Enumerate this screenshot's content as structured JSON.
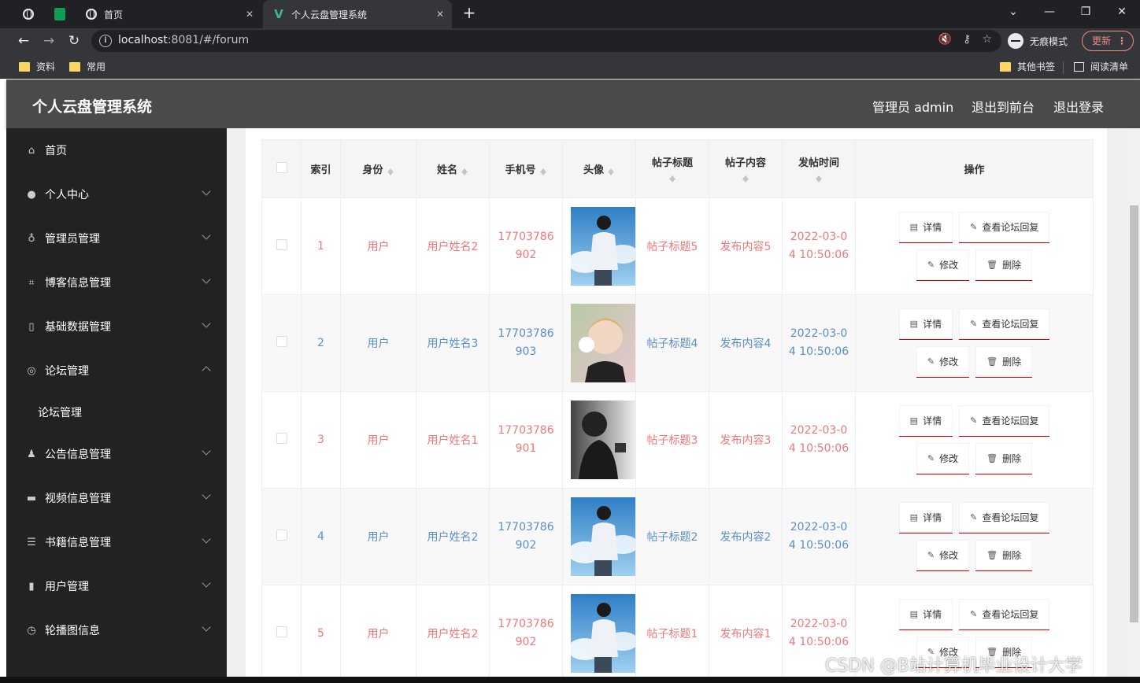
{
  "browser": {
    "tabs": [
      {
        "title": "首页"
      },
      {
        "title": "个人云盘管理系统"
      }
    ],
    "url_host": "localhost",
    "url_rest": ":8081/#/forum",
    "incognito_label": "无痕模式",
    "update_label": "更新",
    "bookmarks": [
      "资料",
      "常用"
    ],
    "bookmarks_right": [
      "其他书签",
      "阅读清单"
    ]
  },
  "app": {
    "title": "个人云盘管理系统",
    "header_links": [
      "管理员 admin",
      "退出到前台",
      "退出登录"
    ]
  },
  "sidebar": {
    "items": [
      {
        "label": "首页",
        "icon": "home-icon",
        "expandable": false
      },
      {
        "label": "个人中心",
        "icon": "user-icon",
        "expandable": true
      },
      {
        "label": "管理员管理",
        "icon": "microphone-icon",
        "expandable": true
      },
      {
        "label": "博客信息管理",
        "icon": "crop-icon",
        "expandable": true
      },
      {
        "label": "基础数据管理",
        "icon": "mic-icon",
        "expandable": true
      },
      {
        "label": "论坛管理",
        "icon": "compass-icon",
        "expandable": true,
        "expanded": true
      },
      {
        "label": "公告信息管理",
        "icon": "person-icon",
        "expandable": true
      },
      {
        "label": "视频信息管理",
        "icon": "monitor-icon",
        "expandable": true
      },
      {
        "label": "书籍信息管理",
        "icon": "list-icon",
        "expandable": true
      },
      {
        "label": "用户管理",
        "icon": "books-icon",
        "expandable": true
      },
      {
        "label": "轮播图信息",
        "icon": "clock-icon",
        "expandable": true
      }
    ],
    "subitem": "论坛管理"
  },
  "table": {
    "headers": [
      "索引",
      "身份",
      "姓名",
      "手机号",
      "头像",
      "帖子标题",
      "帖子内容",
      "发帖时间",
      "操作"
    ],
    "rows": [
      {
        "index": "1",
        "role": "用户",
        "name": "用户姓名2",
        "phone1": "17703786",
        "phone2": "902",
        "title": "帖子标题5",
        "content": "发布内容5",
        "time1": "2022-03-0",
        "time2": "4 10:50:06",
        "color": "red"
      },
      {
        "index": "2",
        "role": "用户",
        "name": "用户姓名3",
        "phone1": "17703786",
        "phone2": "903",
        "title": "帖子标题4",
        "content": "发布内容4",
        "time1": "2022-03-0",
        "time2": "4 10:50:06",
        "color": "blue"
      },
      {
        "index": "3",
        "role": "用户",
        "name": "用户姓名1",
        "phone1": "17703786",
        "phone2": "901",
        "title": "帖子标题3",
        "content": "发布内容3",
        "time1": "2022-03-0",
        "time2": "4 10:50:06",
        "color": "red"
      },
      {
        "index": "4",
        "role": "用户",
        "name": "用户姓名2",
        "phone1": "17703786",
        "phone2": "902",
        "title": "帖子标题2",
        "content": "发布内容2",
        "time1": "2022-03-0",
        "time2": "4 10:50:06",
        "color": "blue"
      },
      {
        "index": "5",
        "role": "用户",
        "name": "用户姓名2",
        "phone1": "17703786",
        "phone2": "902",
        "title": "帖子标题1",
        "content": "发布内容1",
        "time1": "2022-03-0",
        "time2": "4 10:50:06",
        "color": "red"
      }
    ],
    "actions": {
      "detail": "详情",
      "replies": "查看论坛回复",
      "edit": "修改",
      "delete": "删除"
    }
  },
  "watermark": "CSDN @B站计算机毕业设计大学"
}
